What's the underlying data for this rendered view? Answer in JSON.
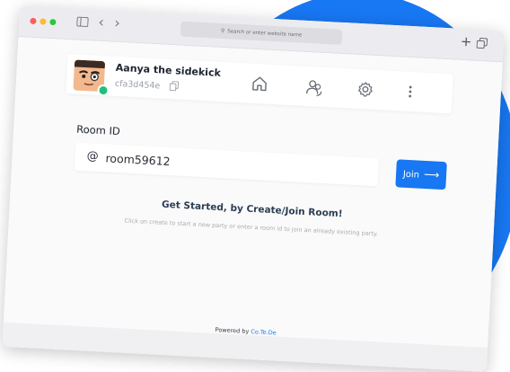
{
  "browser": {
    "url_placeholder": "Search or enter website name",
    "new_tab_symbol": "+",
    "back_symbol": "‹",
    "forward_symbol": "›"
  },
  "user": {
    "name": "Aanya the sidekick",
    "id": "cfa3d454e",
    "status": "online"
  },
  "nav": {
    "icons": [
      "home-icon",
      "users-icon",
      "settings-icon",
      "more-icon"
    ]
  },
  "room": {
    "label": "Room ID",
    "prefix": "@",
    "value": "room59612",
    "join_label": "Join",
    "join_arrow": "⟶"
  },
  "empty_state": {
    "title": "Get Started, by Create/Join Room!",
    "hint": "Click on create to start a new party or enter a room id to join an already existing party."
  },
  "footer": {
    "prefix": "Powered by ",
    "brand": "Co.Te.De"
  },
  "colors": {
    "accent": "#1877f2",
    "status_online": "#20c07a"
  }
}
